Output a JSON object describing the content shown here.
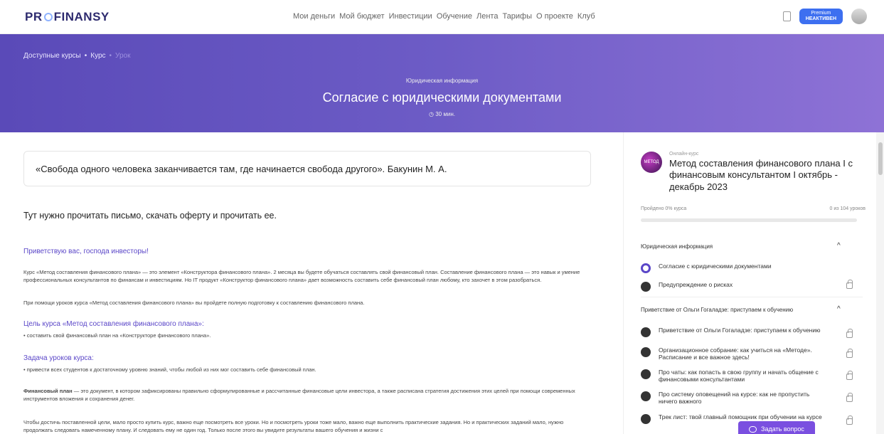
{
  "header": {
    "logo_pre": "PR",
    "logo_post": "FINANSY",
    "nav": [
      "Мои деньги",
      "Мой бюджет",
      "Инвестиции",
      "Обучение",
      "Лента",
      "Тарифы",
      "О проекте",
      "Клуб"
    ],
    "premium_line1": "Premium",
    "premium_line2": "НЕАКТИВЕН"
  },
  "hero": {
    "breadcrumbs": [
      "Доступные курсы",
      "•",
      "Курс",
      "•",
      "Урок"
    ],
    "category": "Юридическая информация",
    "title": "Согласие с юридическими документами",
    "duration": "30 мин."
  },
  "content": {
    "quote": "«Свобода одного человека заканчивается там, где начинается свобода другого». Бакунин М. А.",
    "lead": "Тут нужно прочитать письмо, скачать оферту и прочитать ее.",
    "greeting": "Приветствую вас, господа инвесторы!",
    "para1": "Курс «Метод составления финансового плана» — это элемент «Конструктора финансового плана». 2 месяца вы будете обучаться составлять свой финансовый план. Составление финансового плана — это навык и умение профессиональных консультантов по финансам и инвестициям. Но IT продукт «Конструктор финансового плана» дает возможность составить себе финансовый план любому, кто захочет в этом разобраться.",
    "para2": "При помощи уроков курса «Метод составления финансового плана» вы пройдете полную подготовку к составлению финансового плана.",
    "goal_title": "Цель курса «Метод составления финансового плана»:",
    "goal_item": "составить свой финансовый план на «Конструкторе финансового плана».",
    "task_title": "Задача уроков курса:",
    "task_item": "привести всех студентов к достаточному уровню знаний, чтобы любой из них мог составить себе финансовый план.",
    "fin_bold": "Финансовый план",
    "fin_rest": " — это документ, в котором зафиксированы правильно сформулированные и рассчитанные финансовые цели инвестора, а также расписана стратегия достижения этих целей при помощи современных инструментов вложения и сохранения денег.",
    "para_last": "Чтобы достичь поставленной цели, мало просто купить курс, важно еще посмотреть все уроки. Но и посмотреть уроки тоже мало, важно еще выполнить практические задания. Но и практических заданий мало, нужно продолжать следовать намеченному плану. И следовать ему не один год. Только после этого вы увидите результаты вашего обучения и жизни с"
  },
  "sidebar": {
    "course_logo_text": "МЕТОД",
    "course_type": "Онлайн-курс",
    "course_title": "Метод составления финансового плана I с финансовым консультантом I октябрь - декабрь 2023",
    "progress_label": "Пройдено 0% курса",
    "progress_count": "0 из 104 уроков",
    "progress_value": 0,
    "section1": "Юридическая информация",
    "section1_lessons": [
      "Согласие с юридическими документами",
      "Предупреждение о рисках"
    ],
    "section2": "Приветствие от Ольги Гогаладзе: приступаем к обучению",
    "section2_lessons": [
      "Приветствие от Ольги Гогаладзе: приступаем к обучению",
      "Организационное собрание: как учиться на «Методе». Расписание и все важное здесь!",
      "Про чаты: как попасть в свою группу и начать общение с финансовыми консультантами",
      "Про систему оповещений на курсе: как не пропустить ничего важного",
      "Трек лист: твой главный помощник при обучении на курсе"
    ],
    "chevron": "^"
  },
  "ask_button": "Задать вопрос",
  "colors": {
    "accent": "#5b47c8",
    "button": "#7a4fe0"
  }
}
